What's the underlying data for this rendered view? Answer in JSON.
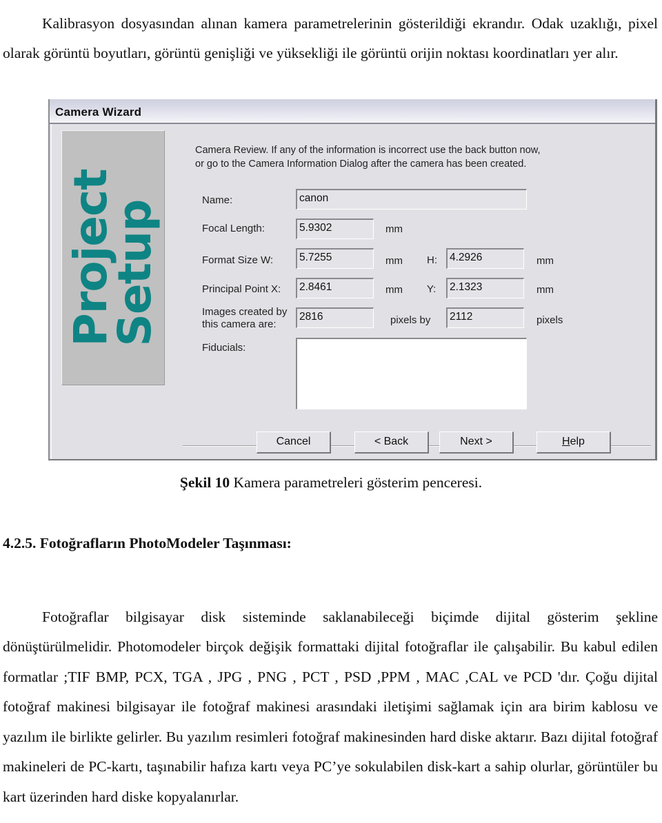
{
  "document": {
    "intro_paragraph": "Kalibrasyon dosyasından alınan kamera parametrelerinin gösterildiği ekrandır. Odak uzaklığı, pixel olarak görüntü boyutları, görüntü genişliği ve yüksekliği ile görüntü orijin noktası koordinatları yer alır.",
    "figure_caption": {
      "label": "Şekil 10",
      "text": " Kamera parametreleri gösterim penceresi."
    },
    "section_heading": "4.2.5. Fotoğrafların PhotoModeler Taşınması:",
    "body_paragraph": "Fotoğraflar bilgisayar disk sisteminde saklanabileceği biçimde dijital gösterim şekline dönüştürülmelidir. Photomodeler birçok değişik formattaki dijital fotoğraflar ile çalışabilir. Bu kabul edilen formatlar ;TIF BMP, PCX, TGA , JPG , PNG , PCT , PSD ,PPM , MAC ,CAL ve PCD 'dır. Çoğu dijital fotoğraf makinesi bilgisayar ile fotoğraf makinesi arasındaki iletişimi sağlamak için ara birim kablosu ve yazılım ile birlikte gelirler. Bu yazılım resimleri fotoğraf makinesinden hard diske aktarır. Bazı dijital fotoğraf makineleri de PC-kartı, taşınabilir hafıza kartı veya PC’ye sokulabilen disk-kart a sahip olurlar, görüntüler bu kart üzerinden hard diske kopyalanırlar."
  },
  "dialog": {
    "title": "Camera Wizard",
    "banner_line1": "Project",
    "banner_line2": "Setup",
    "intro_line1": "Camera Review.  If any of the information is incorrect use the back button now,",
    "intro_line2": "or go to the Camera Information Dialog after the camera has been created.",
    "fields": {
      "name": {
        "label": "Name:",
        "value": "canon"
      },
      "focal_length": {
        "label": "Focal Length:",
        "value": "5.9302",
        "unit": "mm"
      },
      "format_size": {
        "label": "Format Size W:",
        "w_value": "5.7255",
        "w_unit": "mm",
        "h_label": "H:",
        "h_value": "4.2926",
        "h_unit": "mm"
      },
      "principal_point": {
        "label": "Principal Point X:",
        "x_value": "2.8461",
        "x_unit": "mm",
        "y_label": "Y:",
        "y_value": "2.1323",
        "y_unit": "mm"
      },
      "image_size": {
        "label_line1": "Images created by",
        "label_line2": "this camera are:",
        "width_value": "2816",
        "by_label": "pixels by",
        "height_value": "2112",
        "unit": "pixels"
      },
      "fiducials": {
        "label": "Fiducials:",
        "value": ""
      }
    },
    "buttons": {
      "cancel": "Cancel",
      "back": "< Back",
      "next": "Next >",
      "help_mnemonic": "H",
      "help_rest": "elp"
    }
  }
}
